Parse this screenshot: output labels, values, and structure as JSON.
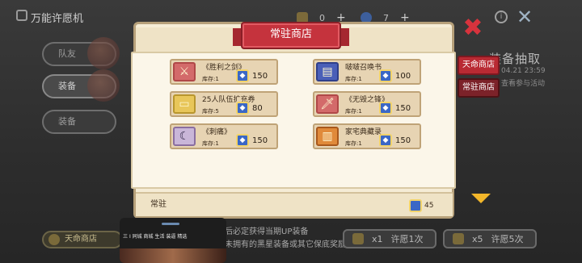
{
  "header": {
    "title": "万能许愿机",
    "resources": [
      {
        "value": "0",
        "icon": "ticket-icon"
      },
      {
        "value": "7",
        "icon": "gem-icon"
      }
    ]
  },
  "left_tabs": [
    {
      "label": "队友"
    },
    {
      "label": "装备"
    },
    {
      "label": "装备"
    }
  ],
  "background": {
    "right_title": "装备抽取",
    "right_sub1": "04.21 23:59",
    "right_sub2": "查看参与活动",
    "bottom_left_button": "天命商店",
    "notes": [
      "后必定获得当期UP装备",
      "未拥有的黑星装备或其它保底奖励"
    ],
    "pull_once": {
      "count": "x1",
      "label": "许愿1次"
    },
    "pull_five": {
      "count": "x5",
      "label": "许愿5次"
    }
  },
  "shop": {
    "title": "常驻商店",
    "tabs": [
      {
        "label": "天命商店"
      },
      {
        "label": "常驻商店"
      }
    ],
    "items": [
      {
        "name": "《胜利之剑》",
        "stock": "库存:1",
        "price": "150",
        "icon": "sword-icon"
      },
      {
        "name": "啵啵召唤书",
        "stock": "库存:1",
        "price": "100",
        "icon": "book-icon"
      },
      {
        "name": "25人队伍扩充券",
        "stock": "库存:5",
        "price": "80",
        "icon": "ticket-icon"
      },
      {
        "name": "《无毁之锋》",
        "stock": "库存:1",
        "price": "150",
        "icon": "blade-icon"
      },
      {
        "name": "《刺痛》",
        "stock": "库存:1",
        "price": "150",
        "icon": "scythe-icon"
      },
      {
        "name": "家宅典藏录",
        "stock": "库存:1",
        "price": "150",
        "icon": "tome-icon"
      }
    ],
    "footer": {
      "label": "常驻",
      "currency_count": "45"
    }
  },
  "mini_window": {
    "tabs": [
      "三",
      "I 同城",
      "商城",
      "生活",
      "装逼",
      "精选"
    ]
  },
  "colors": {
    "accent_red": "#c5333d",
    "panel_bg": "#f5ecd6",
    "card_bg": "#e7d4b3",
    "gem_blue": "#3a67c6"
  }
}
